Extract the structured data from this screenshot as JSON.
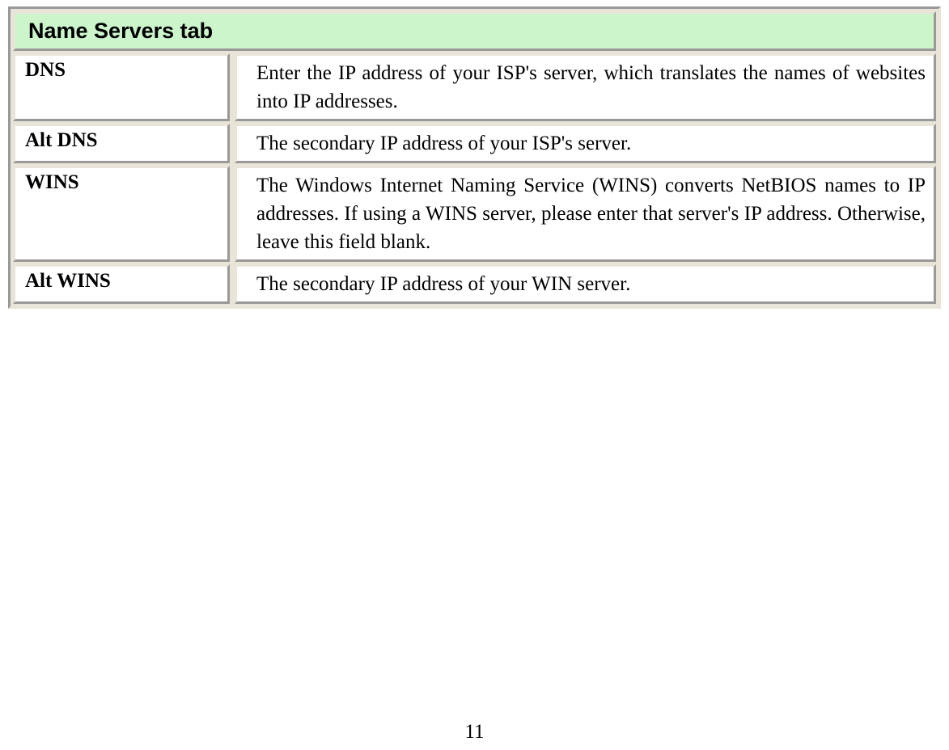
{
  "header": {
    "title": "Name Servers tab"
  },
  "rows": [
    {
      "label": "DNS",
      "description": "Enter the IP address of your ISP's server, which translates the names of websites into IP addresses."
    },
    {
      "label": "Alt DNS",
      "description": "The secondary IP address of your ISP's server."
    },
    {
      "label": "WINS",
      "description": "The Windows Internet Naming Service (WINS) converts NetBIOS names to IP addresses. If using a WINS server, please enter that server's IP address. Otherwise, leave this field blank."
    },
    {
      "label": "Alt WINS",
      "description": "The secondary IP address of your WIN server."
    }
  ],
  "pageNumber": "11"
}
